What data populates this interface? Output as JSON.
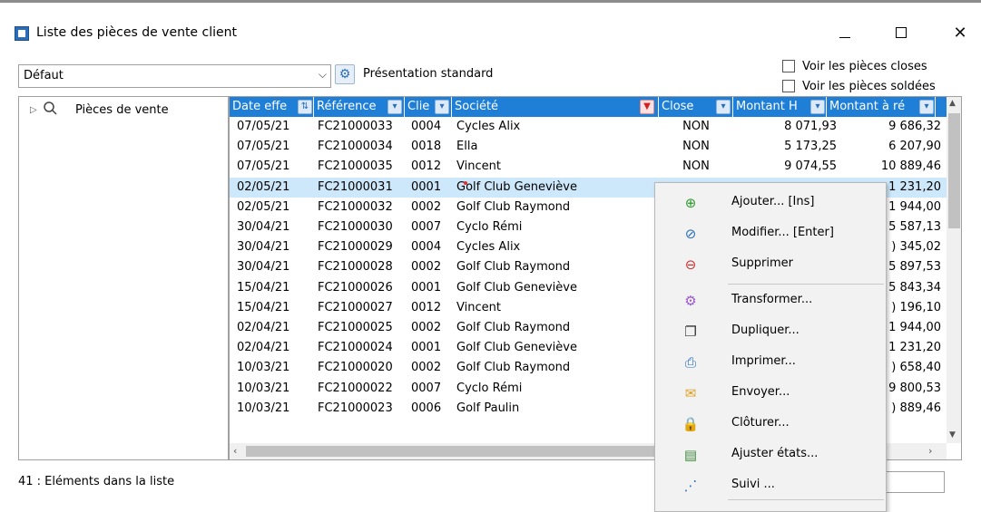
{
  "window": {
    "title": "Liste des pièces de vente client",
    "minimize_label": "—",
    "close_label": "✕"
  },
  "toolbar": {
    "presentation_value": "Défaut",
    "presentation_label": "Présentation standard",
    "show_closed": "Voir les pièces closes",
    "show_settled": "Voir les pièces soldées"
  },
  "tree": {
    "root_label": "Pièces de vente"
  },
  "grid": {
    "columns": {
      "date": "Date effe",
      "ref": "Référence",
      "client": "Clie",
      "societe": "Société",
      "close": "Close",
      "montant_ht": "Montant H",
      "montant_ar": "Montant à ré"
    },
    "rows": [
      {
        "date": "07/05/21",
        "ref": "FC21000033",
        "client": "0004",
        "societe": "Cycles Alix",
        "close": "NON",
        "montant_ht": "8 071,93",
        "montant_ar": "9 686,32"
      },
      {
        "date": "07/05/21",
        "ref": "FC21000034",
        "client": "0018",
        "societe": "Ella",
        "close": "NON",
        "montant_ht": "5 173,25",
        "montant_ar": "6 207,90"
      },
      {
        "date": "07/05/21",
        "ref": "FC21000035",
        "client": "0012",
        "societe": "Vincent",
        "close": "NON",
        "montant_ht": "9 074,55",
        "montant_ar": "10 889,46"
      },
      {
        "date": "02/05/21",
        "ref": "FC21000031",
        "client": "0001",
        "societe": "Golf Club Geneviève",
        "close": "",
        "montant_ht": "",
        "montant_ar": "1 231,20"
      },
      {
        "date": "02/05/21",
        "ref": "FC21000032",
        "client": "0002",
        "societe": "Golf Club Raymond",
        "close": "",
        "montant_ht": "",
        "montant_ar": "1 944,00"
      },
      {
        "date": "30/04/21",
        "ref": "FC21000030",
        "client": "0007",
        "societe": "Cyclo Rémi",
        "close": "",
        "montant_ht": "",
        "montant_ar": "5 587,13"
      },
      {
        "date": "30/04/21",
        "ref": "FC21000029",
        "client": "0004",
        "societe": "Cycles Alix",
        "close": "",
        "montant_ht": "",
        "montant_ar": ") 345,02"
      },
      {
        "date": "30/04/21",
        "ref": "FC21000028",
        "client": "0002",
        "societe": "Golf Club Raymond",
        "close": "",
        "montant_ht": "",
        "montant_ar": "5 897,53"
      },
      {
        "date": "15/04/21",
        "ref": "FC21000026",
        "client": "0001",
        "societe": "Golf Club Geneviève",
        "close": "",
        "montant_ht": "",
        "montant_ar": "5 843,34"
      },
      {
        "date": "15/04/21",
        "ref": "FC21000027",
        "client": "0012",
        "societe": "Vincent",
        "close": "",
        "montant_ht": "",
        "montant_ar": ") 196,10"
      },
      {
        "date": "02/04/21",
        "ref": "FC21000025",
        "client": "0002",
        "societe": "Golf Club Raymond",
        "close": "",
        "montant_ht": "",
        "montant_ar": "1 944,00"
      },
      {
        "date": "02/04/21",
        "ref": "FC21000024",
        "client": "0001",
        "societe": "Golf Club Geneviève",
        "close": "",
        "montant_ht": "",
        "montant_ar": "1 231,20"
      },
      {
        "date": "10/03/21",
        "ref": "FC21000020",
        "client": "0002",
        "societe": "Golf Club Raymond",
        "close": "",
        "montant_ht": "",
        "montant_ar": ") 658,40"
      },
      {
        "date": "10/03/21",
        "ref": "FC21000022",
        "client": "0007",
        "societe": "Cyclo Rémi",
        "close": "",
        "montant_ht": "",
        "montant_ar": "9 800,53"
      },
      {
        "date": "10/03/21",
        "ref": "FC21000023",
        "client": "0006",
        "societe": "Golf Paulin",
        "close": "",
        "montant_ht": "",
        "montant_ar": ") 889,46"
      }
    ]
  },
  "status": {
    "count_text": "41 : Eléments dans la liste"
  },
  "context_menu": {
    "items": [
      {
        "label": "Ajouter... [Ins]",
        "icon": "add-icon",
        "glyph": "⊕",
        "color": "#2e9a2e"
      },
      {
        "label": "Modifier... [Enter]",
        "icon": "edit-icon",
        "glyph": "⊘",
        "color": "#2a6ebb"
      },
      {
        "label": "Supprimer",
        "icon": "delete-icon",
        "glyph": "⊖",
        "color": "#d23030"
      },
      {
        "label": "Transformer...",
        "icon": "transform-icon",
        "glyph": "⚙",
        "color": "#9a58c8"
      },
      {
        "label": "Dupliquer...",
        "icon": "duplicate-icon",
        "glyph": "❐",
        "color": "#333333"
      },
      {
        "label": "Imprimer...",
        "icon": "print-icon",
        "glyph": "⎙",
        "color": "#2a6ebb"
      },
      {
        "label": "Envoyer...",
        "icon": "send-icon",
        "glyph": "✉",
        "color": "#e0a020"
      },
      {
        "label": "Clôturer...",
        "icon": "lock-icon",
        "glyph": "🔒",
        "color": "#e0a020"
      },
      {
        "label": "Ajuster états...",
        "icon": "adjust-states-icon",
        "glyph": "▤",
        "color": "#3a8a3a"
      },
      {
        "label": "Suivi ...",
        "icon": "follow-icon",
        "glyph": "⋰",
        "color": "#2a6ebb"
      }
    ]
  }
}
